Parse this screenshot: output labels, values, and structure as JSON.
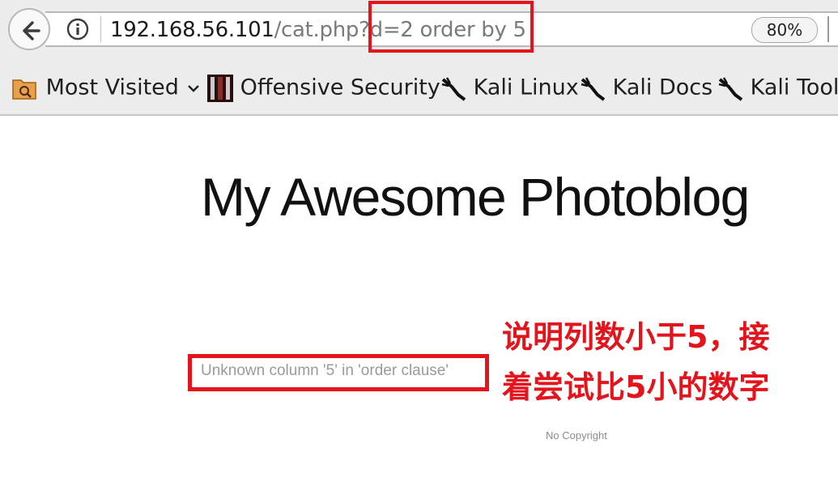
{
  "browser": {
    "url_host": "192.168.56.101",
    "url_path": "/cat.php?",
    "url_query": "d=2 order by 5",
    "zoom": "80%",
    "icons": {
      "back": "back-arrow-icon",
      "info": "info-icon"
    },
    "bookmarks": [
      {
        "label": "Most Visited",
        "icon": "most-visited-folder-icon"
      },
      {
        "label": "Offensive Security",
        "icon": "offensive-security-icon"
      },
      {
        "label": "Kali Linux",
        "icon": "kali-dragon-icon"
      },
      {
        "label": "Kali Docs",
        "icon": "kali-dragon-icon"
      },
      {
        "label": "Kali Tools",
        "icon": "kali-dragon-icon"
      }
    ]
  },
  "page": {
    "title": "My Awesome Photoblog",
    "error": "Unknown column '5' in 'order clause'",
    "footer": "No Copyright"
  },
  "annotation": {
    "line1": "说明列数小于5，接",
    "line2": "着尝试比5小的数字",
    "color": "#e3141b"
  }
}
